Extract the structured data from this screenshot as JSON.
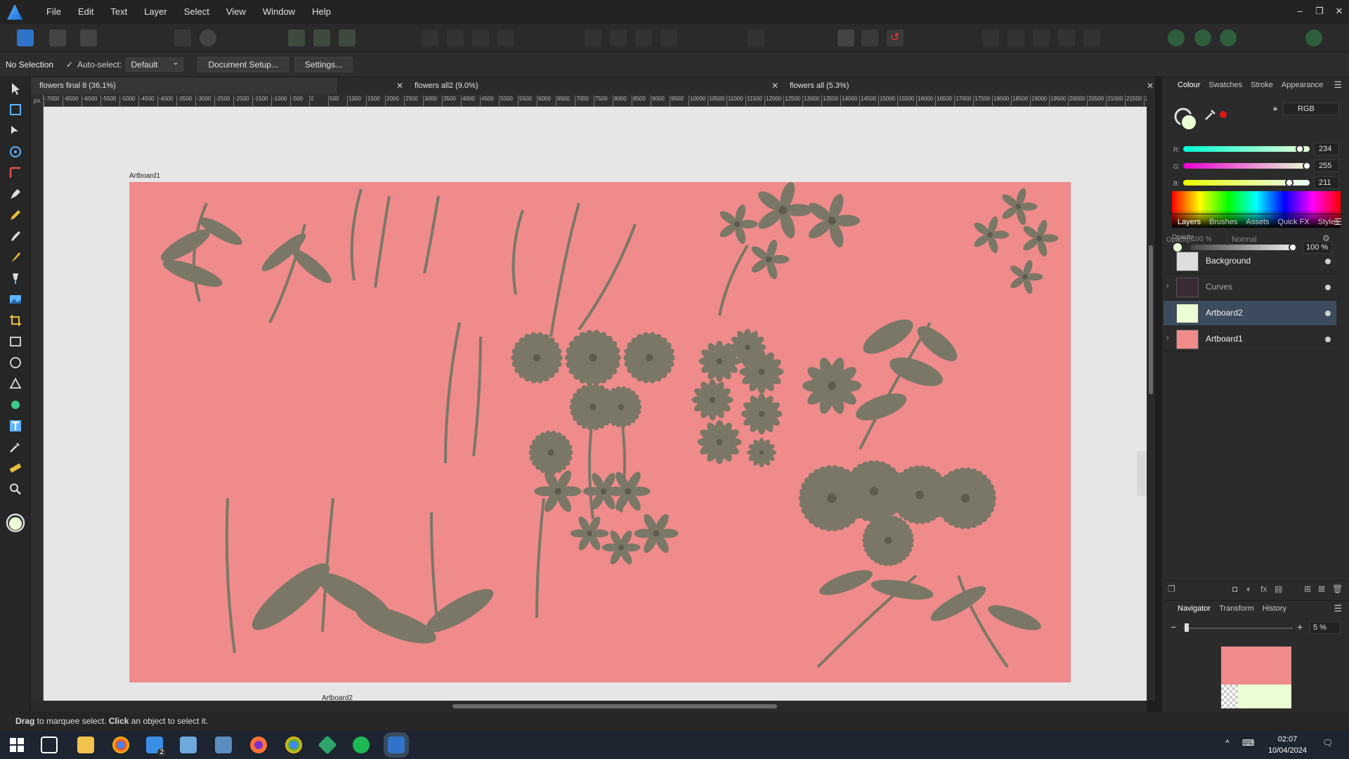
{
  "menubar": {
    "items": [
      "File",
      "Edit",
      "Text",
      "Layer",
      "Select",
      "View",
      "Window",
      "Help"
    ]
  },
  "contextbar": {
    "selection": "No Selection",
    "auto_select_label": "Auto-select:",
    "auto_select_value": "Default",
    "document_setup": "Document Setup...",
    "settings": "Settings..."
  },
  "doctabs": [
    {
      "title": "flowers  final 8 (36.1%)"
    },
    {
      "title": "flowers all2 (9.0%)"
    },
    {
      "title": "flowers all (5.3%)"
    }
  ],
  "ruler": {
    "unit": "px",
    "h_ticks": [
      "-7000",
      "-6500",
      "-6000",
      "-5500",
      "-5000",
      "-4500",
      "-4000",
      "-3500",
      "-3000",
      "-2500",
      "-2000",
      "-1500",
      "-1000",
      "-500",
      "0",
      "500",
      "1000",
      "1500",
      "2000",
      "2500",
      "3000",
      "3500",
      "4000",
      "4500",
      "5000",
      "5500",
      "6000",
      "6500",
      "7000",
      "7500",
      "8000",
      "8500",
      "9000",
      "9500",
      "10000",
      "10500",
      "11000",
      "11500",
      "12000",
      "12500",
      "13000",
      "13500",
      "14000",
      "14500",
      "15000",
      "15500",
      "16000",
      "16500",
      "17000",
      "17500",
      "18000",
      "18500",
      "19000",
      "19500",
      "20000",
      "20500",
      "21000",
      "21500",
      "22000"
    ]
  },
  "canvas": {
    "artboard1_label": "Artboard1",
    "artboard2_label": "Artboard2",
    "artboard_color": "#ef8b8b",
    "flower_color": "#7a7766"
  },
  "colour_panel": {
    "tabs": [
      "Colour",
      "Swatches",
      "Stroke",
      "Appearance"
    ],
    "mode": "RGB",
    "r_label": "R:",
    "r": "234",
    "g_label": "G:",
    "g": "255",
    "b_label": "B:",
    "b": "211",
    "opacity_label": "Opacity",
    "opacity": "100 %"
  },
  "layers_panel": {
    "tabs": [
      "Layers",
      "Brushes",
      "Assets",
      "Quick FX",
      "Styles"
    ],
    "opacity_label": "Opacity:",
    "opacity": "100 %",
    "blend": "Normal",
    "layers": [
      {
        "name": "Background"
      },
      {
        "name": "Curves"
      },
      {
        "name": "Artboard2"
      },
      {
        "name": "Artboard1"
      }
    ]
  },
  "navigator_panel": {
    "tabs": [
      "Navigator",
      "Transform",
      "History"
    ],
    "zoom": "5 %"
  },
  "statusbar": {
    "bold1": "Drag",
    "text1": " to marquee select. ",
    "bold2": "Click",
    "text2": " an object to select it."
  },
  "taskbar": {
    "time": "02:07",
    "date": "10/04/2024",
    "badge": "2"
  }
}
